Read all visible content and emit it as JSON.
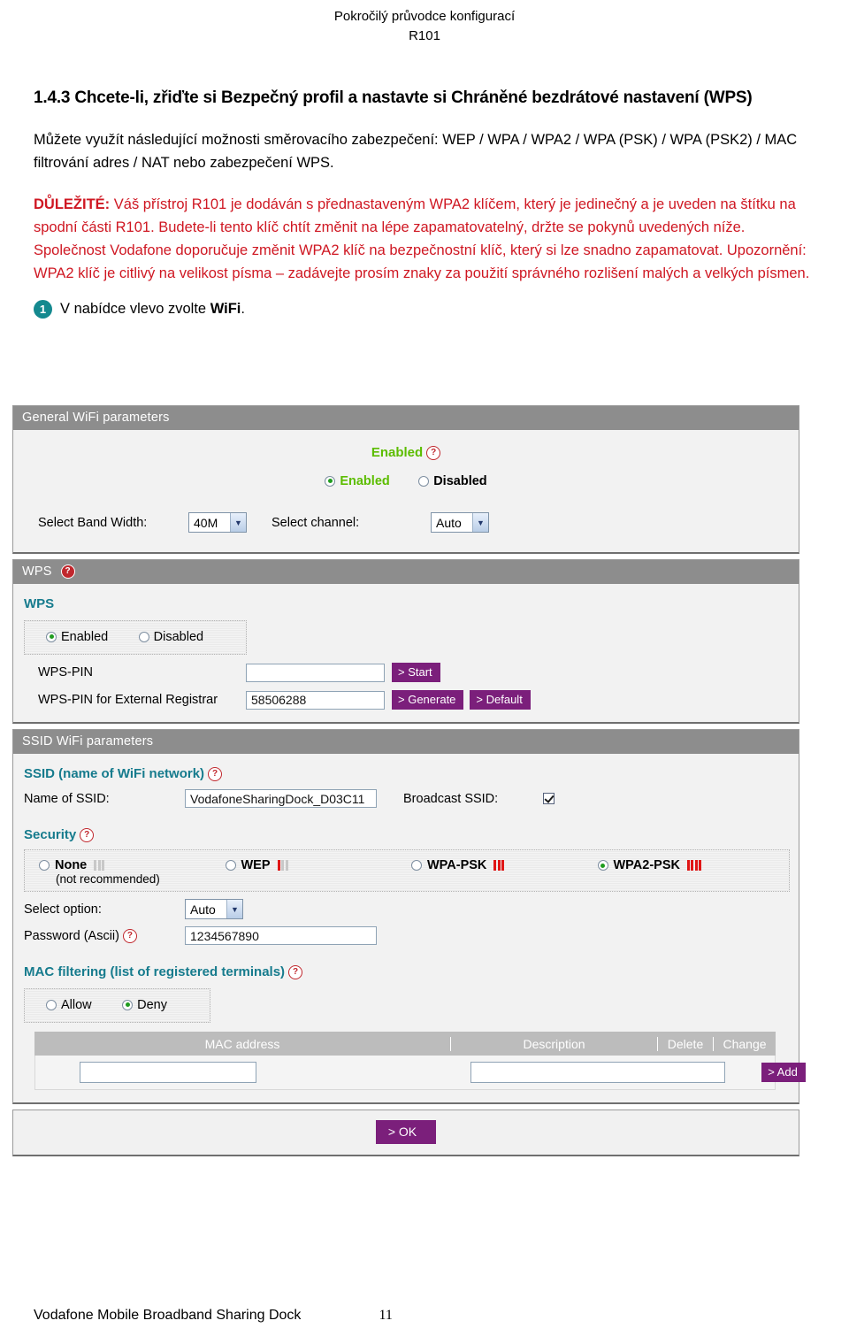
{
  "document": {
    "header_line1": "Pokročilý průvodce konfigurací",
    "header_line2": "R101",
    "section_heading": "1.4.3 Chcete-li, zřiďte si Bezpečný profil a nastavte si Chráněné bezdrátové nastavení (WPS)",
    "intro_paragraph": "Můžete využít následující možnosti směrovacího zabezpečení: WEP / WPA / WPA2 / WPA (PSK) / WPA (PSK2) / MAC filtrování adres / NAT nebo zabezpečení WPS.",
    "important_lead": "DŮLEŽITÉ:",
    "important_text": " Váš přístroj R101 je dodáván s přednastaveným WPA2 klíčem, který je jedinečný a je uveden na štítku na spodní části R101. Budete-li tento klíč chtít změnit na lépe zapamatovatelný, držte se pokynů uvedených níže. Společnost Vodafone doporučuje změnit WPA2 klíč na bezpečnostní klíč, který si lze snadno zapamatovat. Upozornění: WPA2 klíč je citlivý na velikost písma – zadávejte prosím znaky za použití správného rozlišení malých a velkých písmen.",
    "step_number": "1",
    "step_text_pre": "V nabídce vlevo zvolte ",
    "step_text_bold": "WiFi",
    "step_text_post": ".",
    "footer_name": "Vodafone Mobile Broadband Sharing Dock",
    "footer_page": "11"
  },
  "colors": {
    "important_red": "#cf1722",
    "teal_badge": "#14898f",
    "panel_bar_gray": "#8d8d8d",
    "purple_button": "#7b1f7b",
    "enabled_green": "#5cbd00",
    "sub_label_teal": "#167b8d",
    "signal_red": "#e01616"
  },
  "general_wifi": {
    "panel_title": "General WiFi parameters",
    "status_label": "Enabled",
    "help_icon": "help-question-icon",
    "radio_enabled": "Enabled",
    "radio_disabled": "Disabled",
    "selected_radio": "Enabled",
    "band_width_label": "Select Band Width:",
    "band_width_value": "40M",
    "channel_label": "Select channel:",
    "channel_value": "Auto",
    "dropdown_arrow_icon": "chevron-down-icon"
  },
  "wps": {
    "panel_title": "WPS",
    "help_icon": "help-question-icon",
    "sub_label": "WPS",
    "radio_enabled": "Enabled",
    "radio_disabled": "Disabled",
    "selected_radio": "Enabled",
    "pin_label": "WPS-PIN",
    "pin_value": "",
    "pin_start_button": "> Start",
    "registrar_label": "WPS-PIN for External Registrar",
    "registrar_value": "58506288",
    "generate_button": "> Generate",
    "default_button": "> Default"
  },
  "ssid_panel": {
    "panel_title": "SSID WiFi parameters",
    "ssid_group_label": "SSID (name of WiFi network)",
    "name_label": "Name of SSID:",
    "name_value": "VodafoneSharingDock_D03C11",
    "broadcast_label": "Broadcast SSID:",
    "broadcast_checked": true,
    "security_label": "Security",
    "security_options": [
      {
        "label": "None",
        "sublabel": "(not recommended)",
        "selected": false,
        "bars_filled": 0,
        "bars_total": 3
      },
      {
        "label": "WEP",
        "sublabel": "",
        "selected": false,
        "bars_filled": 1,
        "bars_total": 3
      },
      {
        "label": "WPA-PSK",
        "sublabel": "",
        "selected": false,
        "bars_filled": 3,
        "bars_total": 3
      },
      {
        "label": "WPA2-PSK",
        "sublabel": "",
        "selected": true,
        "bars_filled": 4,
        "bars_total": 4
      }
    ],
    "select_option_label": "Select option:",
    "select_option_value": "Auto",
    "password_label": "Password (Ascii)",
    "password_value": "1234567890",
    "mac_filter_label": "MAC filtering (list of registered terminals)",
    "mac_filter_allow": "Allow",
    "mac_filter_deny": "Deny",
    "mac_filter_selected": "Deny",
    "table": {
      "headers": [
        "MAC address",
        "Description",
        "Delete",
        "Change"
      ],
      "row_mac_value": "",
      "row_desc_value": "",
      "add_button": "> Add"
    }
  },
  "ok_bar": {
    "ok_button": "> OK"
  }
}
